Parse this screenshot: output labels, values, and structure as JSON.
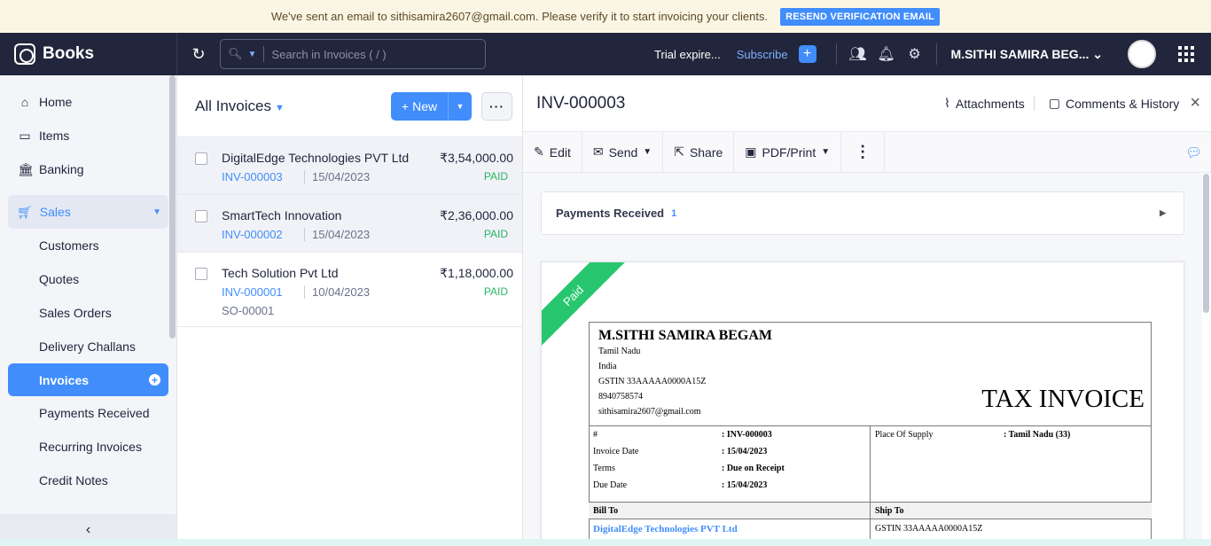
{
  "banner": {
    "message": "We've sent an email to sithisamira2607@gmail.com. Please verify it to start invoicing your clients.",
    "button": "RESEND VERIFICATION EMAIL"
  },
  "topbar": {
    "app_name": "Books",
    "search_placeholder": "Search in Invoices ( / )",
    "trial": "Trial expire...",
    "subscribe": "Subscribe",
    "org_name": "M.SITHI SAMIRA BEG..."
  },
  "sidebar": {
    "main_items": [
      {
        "label": "Home",
        "icon": "home-icon"
      },
      {
        "label": "Items",
        "icon": "items-icon"
      },
      {
        "label": "Banking",
        "icon": "bank-icon"
      }
    ],
    "sales_label": "Sales",
    "sales_items": [
      "Customers",
      "Quotes",
      "Sales Orders",
      "Delivery Challans",
      "Invoices",
      "Payments Received",
      "Recurring Invoices",
      "Credit Notes"
    ]
  },
  "list": {
    "title": "All Invoices",
    "new_label": "New",
    "rows": [
      {
        "name": "DigitalEdge Technologies PVT Ltd",
        "amount": "₹3,54,000.00",
        "number": "INV-000003",
        "date": "15/04/2023",
        "status": "PAID",
        "ref": ""
      },
      {
        "name": "SmartTech Innovation",
        "amount": "₹2,36,000.00",
        "number": "INV-000002",
        "date": "15/04/2023",
        "status": "PAID",
        "ref": ""
      },
      {
        "name": "Tech Solution Pvt Ltd",
        "amount": "₹1,18,000.00",
        "number": "INV-000001",
        "date": "10/04/2023",
        "status": "PAID",
        "ref": "SO-00001"
      }
    ]
  },
  "detail": {
    "title": "INV-000003",
    "attachments": "Attachments",
    "comments": "Comments & History",
    "toolbar": {
      "edit": "Edit",
      "send": "Send",
      "share": "Share",
      "pdf": "PDF/Print"
    },
    "payments_received": "Payments Received",
    "payments_count": "1",
    "ribbon": "Paid",
    "invoice": {
      "org_name": "M.SITHI SAMIRA BEGAM",
      "org_lines": [
        "Tamil Nadu",
        "India",
        "GSTIN 33AAAAA0000A15Z",
        "8940758574",
        "sithisamira2607@gmail.com"
      ],
      "doc_title": "TAX INVOICE",
      "meta": [
        {
          "k": "#",
          "v": ": INV-000003"
        },
        {
          "k": "Invoice Date",
          "v": ": 15/04/2023"
        },
        {
          "k": "Terms",
          "v": ": Due on Receipt"
        },
        {
          "k": "Due Date",
          "v": ": 15/04/2023"
        }
      ],
      "place_of_supply_label": "Place Of Supply",
      "place_of_supply": ": Tamil Nadu (33)",
      "bill_to_label": "Bill To",
      "ship_to_label": "Ship To",
      "bill_to_name": "DigitalEdge Technologies PVT Ltd",
      "ship_to_gstin": "GSTIN 33AAAAA0000A15Z"
    }
  },
  "colors": {
    "accent": "#408dfb",
    "topbar": "#21263c",
    "paid": "#28b463"
  }
}
